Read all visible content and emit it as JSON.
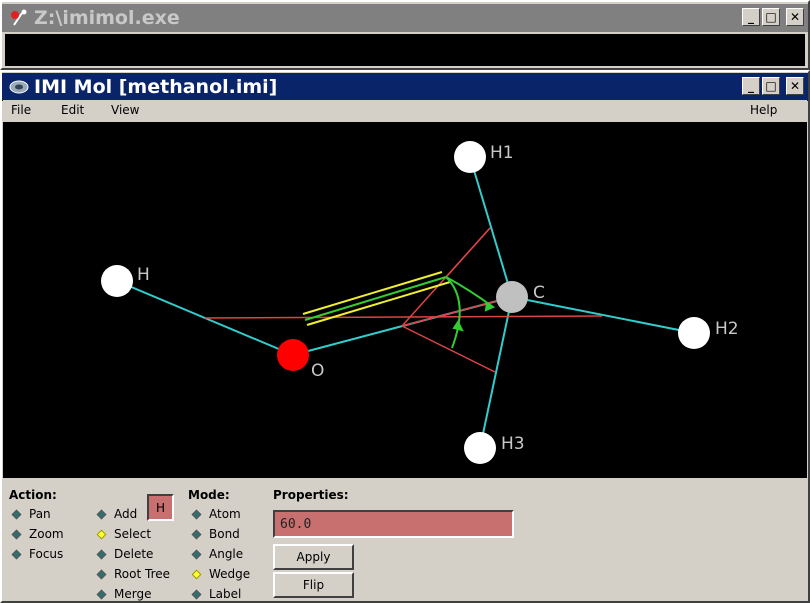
{
  "outer_window": {
    "title": "Z:\\imimol.exe"
  },
  "inner_window": {
    "title": "IMI Mol [methanol.imi]"
  },
  "title_buttons": {
    "minimize": "_",
    "maximize": "□",
    "close": "✕"
  },
  "menubar": {
    "file": "File",
    "edit": "Edit",
    "view": "View",
    "help": "Help"
  },
  "molecule": {
    "atoms": {
      "h1": "H1",
      "h": "H",
      "c": "C",
      "h2": "H2",
      "o": "O",
      "h3": "H3"
    }
  },
  "controls": {
    "action_label": "Action:",
    "actions": [
      "Pan",
      "Zoom",
      "Focus"
    ],
    "tools": [
      "Add",
      "Select",
      "Delete",
      "Root Tree",
      "Merge"
    ],
    "selected_tool": "Select",
    "element": "H",
    "mode_label": "Mode:",
    "modes": [
      "Atom",
      "Bond",
      "Angle",
      "Wedge",
      "Label"
    ],
    "selected_mode": "Wedge",
    "properties_label": "Properties:",
    "properties_value": "60.0",
    "apply_label": "Apply",
    "flip_label": "Flip"
  },
  "colors": {
    "bond": "#33cccc",
    "wedge_red": "#dd4444",
    "wedge_green": "#33cc33",
    "wedge_yellow": "#eeee33",
    "oxygen": "#ff0000",
    "carbon": "#c0c0c0",
    "hydrogen": "#ffffff",
    "title_active": "#0a246a",
    "title_inactive": "#808080"
  }
}
